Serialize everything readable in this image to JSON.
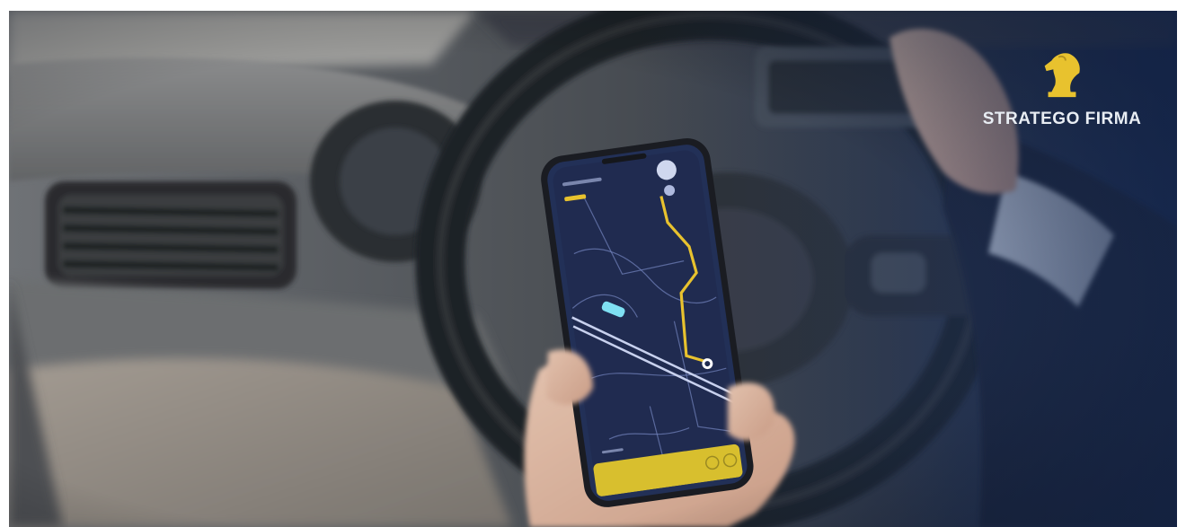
{
  "brand": {
    "name": "STRATEGO FIRMA",
    "icon": "chess-knight-icon"
  },
  "colors": {
    "accent_yellow": "#e8c22e",
    "map_background": "#1f2a4d",
    "map_lines": "#8c9ccf",
    "vignette_blue": "#1d3566",
    "phone_bar": "#d8bf2e"
  }
}
